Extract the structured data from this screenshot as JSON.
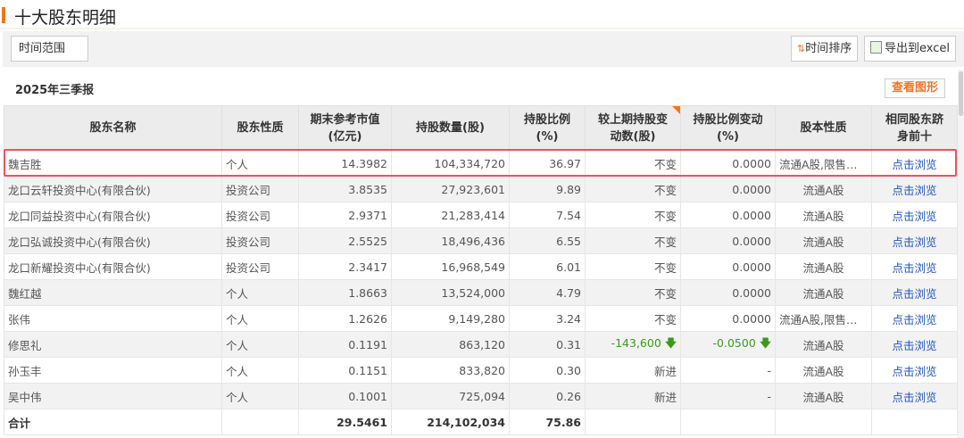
{
  "title": "十大股东明细",
  "toolbar": {
    "time_range": "时间范围",
    "sort": "时间排序",
    "export": "导出到excel"
  },
  "section": "2025年三季报",
  "chart_button": "查看图形",
  "headers": [
    "股东名称",
    "股东性质",
    "期末参考市值\n(亿元)",
    "持股数量(股)",
    "持股比例\n(%)",
    "较上期持股变\n动数(股)",
    "持股比例变动\n(%)",
    "股本性质",
    "相同股东跻\n身前十"
  ],
  "rows": [
    [
      "魏吉胜",
      "个人",
      "14.3982",
      "104,334,720",
      "36.97",
      "不变",
      "0.0000",
      "流通A股,限售…",
      "点击浏览"
    ],
    [
      "龙口云轩投资中心(有限合伙)",
      "投资公司",
      "3.8535",
      "27,923,601",
      "9.89",
      "不变",
      "0.0000",
      "流通A股",
      "点击浏览"
    ],
    [
      "龙口同益投资中心(有限合伙)",
      "投资公司",
      "2.9371",
      "21,283,414",
      "7.54",
      "不变",
      "0.0000",
      "流通A股",
      "点击浏览"
    ],
    [
      "龙口弘诚投资中心(有限合伙)",
      "投资公司",
      "2.5525",
      "18,496,436",
      "6.55",
      "不变",
      "0.0000",
      "流通A股",
      "点击浏览"
    ],
    [
      "龙口新耀投资中心(有限合伙)",
      "投资公司",
      "2.3417",
      "16,968,549",
      "6.01",
      "不变",
      "0.0000",
      "流通A股",
      "点击浏览"
    ],
    [
      "魏红越",
      "个人",
      "1.8663",
      "13,524,000",
      "4.79",
      "不变",
      "0.0000",
      "流通A股",
      "点击浏览"
    ],
    [
      "张伟",
      "个人",
      "1.2626",
      "9,149,280",
      "3.24",
      "不变",
      "0.0000",
      "流通A股,限售…",
      "点击浏览"
    ],
    [
      "修思礼",
      "个人",
      "0.1191",
      "863,120",
      "0.31",
      "-143,600",
      "-0.0500",
      "流通A股",
      "点击浏览"
    ],
    [
      "孙玉丰",
      "个人",
      "0.1151",
      "833,820",
      "0.30",
      "新进",
      "-",
      "流通A股",
      "点击浏览"
    ],
    [
      "吴中伟",
      "个人",
      "0.1001",
      "725,094",
      "0.26",
      "新进",
      "-",
      "流通A股",
      "点击浏览"
    ]
  ],
  "total": {
    "label": "合计",
    "market_value": "29.5461",
    "shares": "214,102,034",
    "ratio": "75.86"
  },
  "colors": {
    "accent": "#f5731f",
    "decrease": "#3a9a1a",
    "link": "#2255bb",
    "highlight": "#f0505a"
  }
}
